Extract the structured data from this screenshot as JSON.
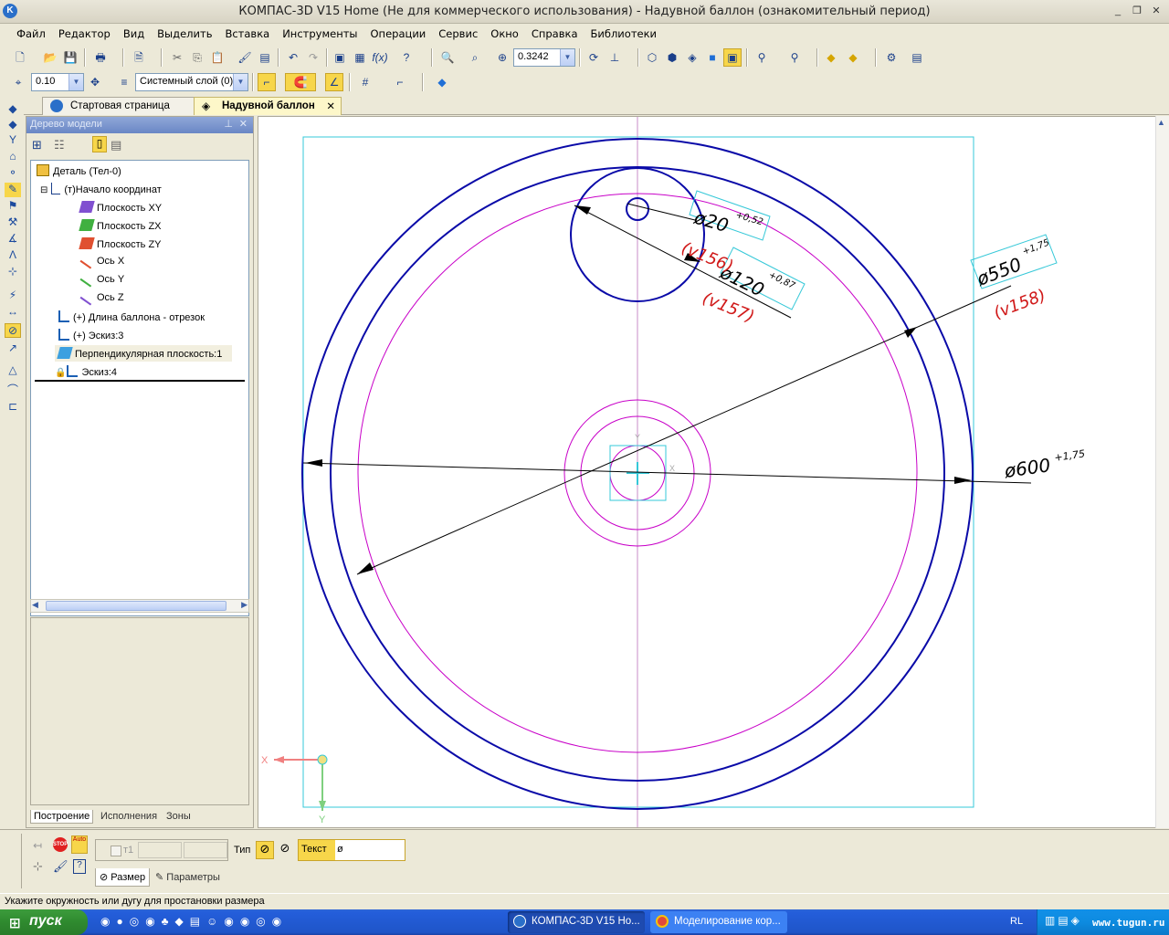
{
  "window": {
    "title": "КОМПАС-3D V15 Home (Не для коммерческого использования) - Надувной баллон (ознакомительный период)"
  },
  "menu": [
    "Файл",
    "Редактор",
    "Вид",
    "Выделить",
    "Вставка",
    "Инструменты",
    "Операции",
    "Сервис",
    "Окно",
    "Справка",
    "Библиотеки"
  ],
  "toolbar": {
    "zoom_value": "0.3242",
    "step_value": "0.10",
    "layer_value": "Системный слой (0)"
  },
  "tabs": [
    {
      "label": "Стартовая страница",
      "active": false
    },
    {
      "label": "Надувной баллон",
      "active": true
    }
  ],
  "tree": {
    "header": "Дерево модели",
    "nodes": [
      {
        "label": "Деталь (Тел-0)",
        "icon": "part-icon"
      },
      {
        "label": "(т)Начало координат",
        "icon": "origin-icon"
      },
      {
        "label": "Плоскость XY",
        "icon": "plane-xy-icon"
      },
      {
        "label": "Плоскость ZX",
        "icon": "plane-zx-icon"
      },
      {
        "label": "Плоскость ZY",
        "icon": "plane-zy-icon"
      },
      {
        "label": "Ось X",
        "icon": "axis-x-icon"
      },
      {
        "label": "Ось Y",
        "icon": "axis-y-icon"
      },
      {
        "label": "Ось Z",
        "icon": "axis-z-icon"
      },
      {
        "label": "(+) Длина баллона - отрезок",
        "icon": "sketch-icon"
      },
      {
        "label": "(+) Эскиз:3",
        "icon": "sketch-icon"
      },
      {
        "label": "Перпендикулярная плоскость:1",
        "icon": "plane-icon"
      },
      {
        "label": "Эскиз:4",
        "icon": "sketch-icon"
      }
    ],
    "bottom_tabs": [
      "Построение",
      "Исполнения",
      "Зоны"
    ]
  },
  "drawing": {
    "dim_20": "ø20",
    "dim_20_tol": "+0,52",
    "dim_120": "ø120",
    "dim_120_tol": "+0,87",
    "dim_550": "ø550",
    "dim_550_tol": "+1,75",
    "dim_600": "ø600",
    "dim_600_tol": "+1,75",
    "var_156": "(v156)",
    "var_157": "(v157)",
    "var_158": "(v158)",
    "axis_x": "X",
    "axis_y": "Y",
    "colors": {
      "main": "#0a0aa8",
      "magenta": "#c800c8",
      "cyan": "#35c8d8",
      "red_var": "#d01818"
    }
  },
  "propbar": {
    "t1_label": "т1",
    "type_label": "Тип",
    "text_label": "Текст",
    "text_value": "ø",
    "tab_size": "Размер",
    "tab_params": "Параметры"
  },
  "status": "Укажите окружность или дугу для простановки размера",
  "taskbar": {
    "start": "пуск",
    "tasks": [
      "КОМПАС-3D V15 Ho...",
      "Моделирование кор..."
    ],
    "lang": "RL",
    "watermark": "www.tugun.ru"
  }
}
